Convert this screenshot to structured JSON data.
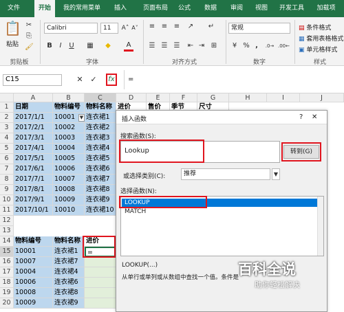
{
  "tabs": [
    "文件",
    "开始",
    "我的常用菜单",
    "插入",
    "页面布局",
    "公式",
    "数据",
    "审阅",
    "视图",
    "开发工具",
    "加载项"
  ],
  "ribbon": {
    "paste_label": "粘贴",
    "clipboard_label": "剪贴板",
    "font_name": "Calibri",
    "font_size": "11",
    "font_label": "字体",
    "align_label": "对齐方式",
    "number_format": "常规",
    "number_label": "数字",
    "style_items": [
      "条件格式",
      "套用表格格式",
      "单元格样式"
    ],
    "style_label": "样式",
    "bold": "B",
    "italic": "I",
    "underline": "U",
    "font_color_glyph": "A",
    "percent": "%",
    "comma": ","
  },
  "formula_bar": {
    "name_box": "C15",
    "content": "="
  },
  "columns": [
    "A",
    "B",
    "C",
    "D",
    "E",
    "F",
    "G",
    "H",
    "I",
    "J"
  ],
  "rows": [
    "1",
    "2",
    "3",
    "4",
    "5",
    "6",
    "7",
    "8",
    "9",
    "10",
    "11",
    "12",
    "13",
    "14",
    "15",
    "16",
    "17",
    "18",
    "19",
    "20"
  ],
  "table1": {
    "headers": [
      "日期",
      "物料编号",
      "物料名称",
      "进价",
      "售价",
      "季节",
      "尺寸"
    ],
    "rows": [
      [
        "2017/1/1",
        "10001",
        "连衣裙1"
      ],
      [
        "2017/2/1",
        "10002",
        "连衣裙2"
      ],
      [
        "2017/3/1",
        "10003",
        "连衣裙3"
      ],
      [
        "2017/4/1",
        "10004",
        "连衣裙4"
      ],
      [
        "2017/5/1",
        "10005",
        "连衣裙5"
      ],
      [
        "2017/6/1",
        "10006",
        "连衣裙6"
      ],
      [
        "2017/7/1",
        "10007",
        "连衣裙7"
      ],
      [
        "2017/8/1",
        "10008",
        "连衣裙8"
      ],
      [
        "2017/9/1",
        "10009",
        "连衣裙9"
      ],
      [
        "2017/10/1",
        "10010",
        "连衣裙10"
      ]
    ]
  },
  "table2": {
    "headers": [
      "物料编号",
      "物料名称",
      "进价"
    ],
    "rows": [
      [
        "10001",
        "连衣裙1",
        "="
      ],
      [
        "10007",
        "连衣裙7",
        ""
      ],
      [
        "10004",
        "连衣裙4",
        ""
      ],
      [
        "10006",
        "连衣裙6",
        ""
      ],
      [
        "10008",
        "连衣裙8",
        ""
      ],
      [
        "10009",
        "连衣裙9",
        ""
      ]
    ]
  },
  "dialog": {
    "title": "插入函数",
    "help": "?",
    "close": "✕",
    "search_label": "搜索函数(S):",
    "search_value": "Lookup",
    "go_button": "转到(G)",
    "category_label": "或选择类别(C):",
    "category_value": "推荐",
    "select_label": "选择函数(N):",
    "functions": [
      "LOOKUP",
      "MATCH"
    ],
    "signature": "LOOKUP(...)",
    "description": "从单行或单列或从数组中查找一个值。条件是"
  },
  "watermark": {
    "title": "百科全说",
    "subtitle": "助你轻松解决"
  },
  "colors": {
    "excel_green": "#217346",
    "header_blue": "#bdd7ee",
    "highlight_red": "#e0141e",
    "selection": "#0078d7"
  }
}
